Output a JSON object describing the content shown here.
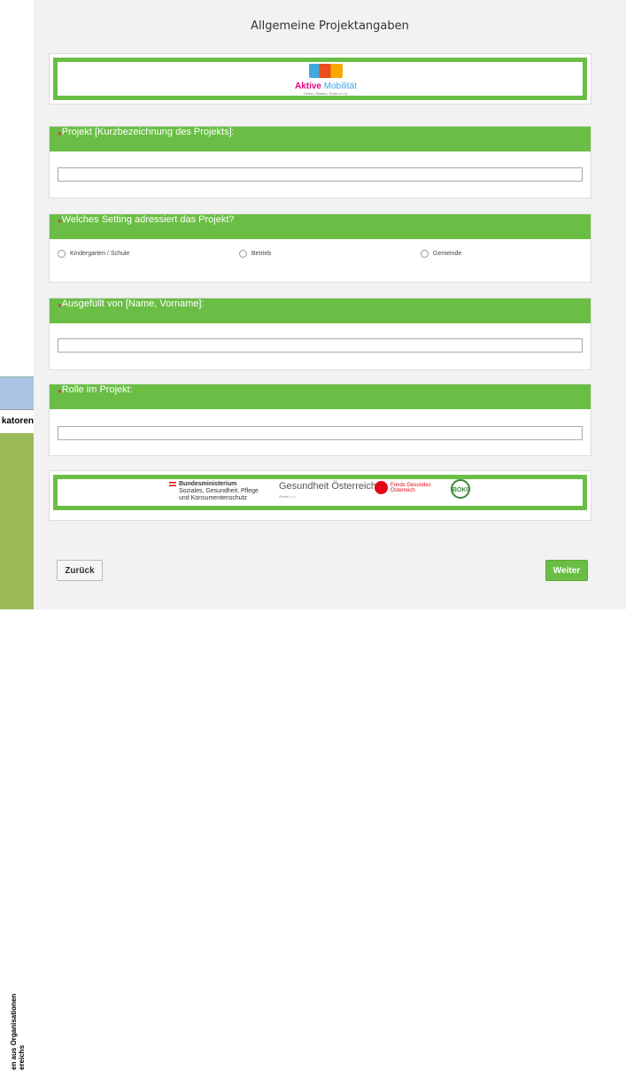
{
  "sidebar": {
    "fragment_label": "katoren",
    "vertical_line1": "en aus Organisationen",
    "vertical_line2": "ereichs"
  },
  "page": {
    "title": "Allgemeine Projektangaben"
  },
  "header_logo": {
    "name_part1": "Aktive",
    "name_part2": "Mobilität",
    "tagline": "Gehen. Radeln. Roller & Co."
  },
  "sections": [
    {
      "required_mark": "*",
      "label": "Projekt [Kurzbezeichnung des Projekts]:",
      "value": ""
    },
    {
      "required_mark": "*",
      "label": "Welches Setting adressiert das Projekt?",
      "options": [
        "Kindergarten / Schule",
        "Betrieb",
        "Gemeinde"
      ]
    },
    {
      "required_mark": "*",
      "label": "Ausgefüllt von [Name, Vorname]:",
      "value": ""
    },
    {
      "required_mark": "*",
      "label": "Rolle im Projekt:",
      "value": ""
    }
  ],
  "footer_logos": {
    "ministry_line1": "Bundesministerium",
    "ministry_line2": "Soziales, Gesundheit, Pflege",
    "ministry_line3": "und Konsumentenschutz",
    "goe": "Gesundheit Österreich",
    "goe_sub": "GmbH • • •",
    "fgoe_line1": "Fonds Gesundes",
    "fgoe_line2": "Österreich",
    "boku": "BOKU"
  },
  "buttons": {
    "back": "Zurück",
    "next": "Weiter"
  },
  "colors": {
    "accent_green": "#6abe45",
    "required_red": "#d9262b"
  }
}
